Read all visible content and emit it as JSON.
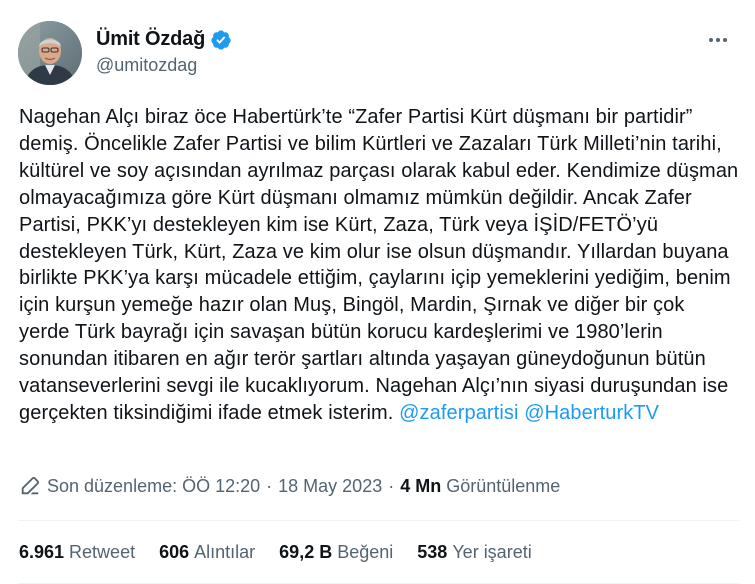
{
  "author": {
    "display_name": "Ümit Özdağ",
    "handle": "@umitozdag",
    "verified": true,
    "avatar_icon": "profile-photo"
  },
  "tweet": {
    "text": "Nagehan Alçı biraz öce Habertürk’te “Zafer Partisi Kürt düşmanı bir partidir” demiş. Öncelikle Zafer Partisi ve bilim Kürtleri ve Zazaları Türk Milleti’nin tarihi, kültürel ve soy açısından ayrılmaz parçası olarak kabul eder. Kendimize düşman olmayacağımıza göre Kürt düşmanı olmamız mümkün değildir. Ancak Zafer Partisi, PKK’yı destekleyen kim ise Kürt, Zaza, Türk veya İŞİD/FETÖ’yü destekleyen Türk, Kürt, Zaza ve kim olur ise olsun düşmandır. Yıllardan buyana birlikte PKK’ya karşı mücadele ettiğim, çaylarını içip yemeklerini yediğim, benim için kurşun yemeğe hazır olan Muş, Bingöl, Mardin, Şırnak ve diğer bir çok yerde Türk bayrağı için savaşan bütün korucu kardeşlerimi ve 1980’lerin sonundan itibaren en ağır terör şartları altında yaşayan güneydoğunun bütün vatanseverlerini sevgi ile kucaklıyorum. Nagehan Alçı’nın siyasi duruşundan ise gerçekten tiksindiğimi ifade etmek isterim.",
    "mention_1": "@zaferpartisi",
    "mention_2": "@HaberturkTV"
  },
  "meta": {
    "edited_label": "Son düzenleme:",
    "time": "ÖÖ 12:20",
    "separator": "·",
    "date": "18 May 2023",
    "views_value": "4 Mn",
    "views_label": "Görüntülenme"
  },
  "stats": [
    {
      "value": "6.961",
      "label": "Retweet"
    },
    {
      "value": "606",
      "label": "Alıntılar"
    },
    {
      "value": "69,2 B",
      "label": "Beğeni"
    },
    {
      "value": "538",
      "label": "Yer işareti"
    }
  ],
  "colors": {
    "accent": "#1d9bf0",
    "text": "#0f1419",
    "secondary": "#536471"
  }
}
